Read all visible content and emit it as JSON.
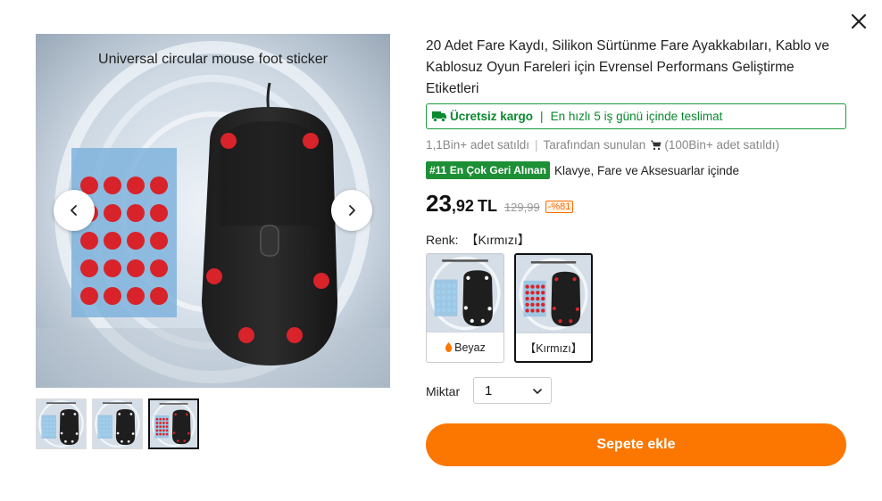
{
  "gallery": {
    "main_caption": "Universal circular mouse foot sticker",
    "thumbnail_count": 3,
    "active_thumbnail": 3
  },
  "product": {
    "title": "20 Adet Fare Kaydı, Silikon Sürtünme Fare Ayakkabıları, Kablo ve Kablosuz Oyun Fareleri için Evrensel Performans Geliştirme Etiketleri",
    "shipping": {
      "free_label": "Ücretsiz kargo",
      "delivery_label": "En hızlı 5 iş günü içinde teslimat"
    },
    "sales": {
      "sold": "1,1Bin+ adet satıldı",
      "seller_prefix": "Tarafından sunulan",
      "seller_sold": "(100Bin+ adet satıldı)"
    },
    "rank": {
      "badge": "#11 En Çok Geri Alınan",
      "category": "Klavye, Fare ve Aksesuarlar içinde"
    },
    "price": {
      "integer": "23",
      "decimal": ",92",
      "currency": "TL",
      "old_price": "129,99",
      "discount": "-%81"
    },
    "color": {
      "label": "Renk:",
      "selected": "【Kırmızı】",
      "options": [
        {
          "label": "Beyaz",
          "icon": "flame-icon",
          "dots": "#9fd0ee"
        },
        {
          "label": "【Kırmızı】",
          "dots": "#d8232a"
        }
      ]
    },
    "quantity": {
      "label": "Miktar",
      "value": "1"
    },
    "add_to_cart": "Sepete ekle"
  },
  "colors": {
    "accent_orange": "#fb7701",
    "green": "#1a9b3c",
    "sticker_red": "#d8232a",
    "sticker_blue": "#9fd0ee"
  }
}
